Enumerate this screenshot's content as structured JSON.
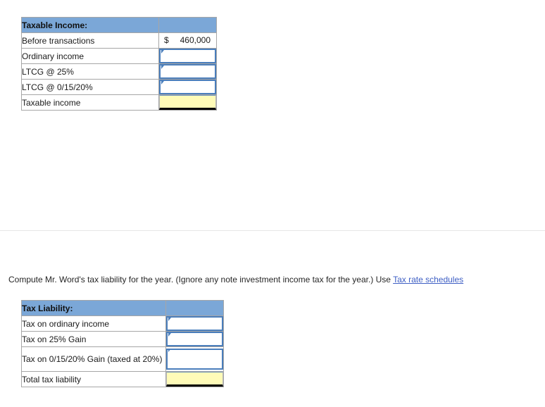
{
  "taxable_income_table": {
    "name": "Taxable Income worksheet",
    "header": {
      "label": "Taxable Income:",
      "value": ""
    },
    "rows": [
      {
        "label": "Before transactions",
        "kind": "money",
        "currency": "$",
        "amount": "460,000"
      },
      {
        "label": "Ordinary income",
        "kind": "input",
        "value": "",
        "placeholder": ""
      },
      {
        "label": "LTCG @ 25%",
        "kind": "input",
        "value": "",
        "placeholder": ""
      },
      {
        "label": "LTCG @ 0/15/20%",
        "kind": "input",
        "value": "",
        "placeholder": ""
      },
      {
        "label": "Taxable income",
        "kind": "total",
        "value": ""
      }
    ]
  },
  "prompt": {
    "text_before_link": "Compute Mr. Word's tax liability for the year.  (Ignore any note investment income tax for the year.) Use ",
    "link_label": "Tax rate schedules"
  },
  "tax_liability_table": {
    "name": "Tax Liability worksheet",
    "header": {
      "label": "Tax Liability:",
      "value": ""
    },
    "rows": [
      {
        "label": "Tax on ordinary income",
        "kind": "input",
        "value": "",
        "placeholder": ""
      },
      {
        "label": "Tax on 25% Gain",
        "kind": "input",
        "value": "",
        "placeholder": ""
      },
      {
        "label": "Tax on 0/15/20% Gain (taxed at 20%)",
        "kind": "input",
        "value": "",
        "placeholder": ""
      },
      {
        "label": "Total tax liability",
        "kind": "total",
        "value": ""
      }
    ]
  },
  "colors": {
    "header_blue": "#7BA7D7",
    "input_border_blue": "#4a7ebc",
    "total_yellow": "#FFFBB8",
    "link_blue": "#3d5ec4",
    "grid_gray": "#a6a6a6"
  }
}
